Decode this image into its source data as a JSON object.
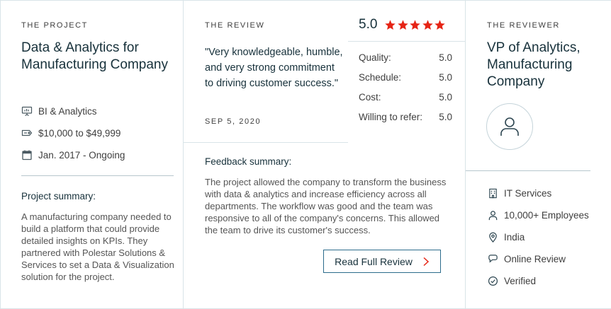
{
  "project": {
    "eyebrow": "THE PROJECT",
    "title": "Data & Analytics for Manufacturing Company",
    "service": "BI & Analytics",
    "budget": "$10,000 to $49,999",
    "timeline": "Jan. 2017 - Ongoing",
    "summary_heading": "Project summary:",
    "summary": "A manufacturing company needed to build a platform that could provide detailed insights on KPIs. They partnered with Polestar Solutions & Services to set a Data & Visualization solution for the project."
  },
  "review": {
    "eyebrow": "THE REVIEW",
    "quote": "\"Very knowledgeable, humble, and very strong commitment to driving customer success.\"",
    "date": "SEP 5, 2020",
    "overall_rating": "5.0",
    "stars": 5,
    "star_color": "#e62415",
    "scores": [
      {
        "label": "Quality:",
        "value": "5.0"
      },
      {
        "label": "Schedule:",
        "value": "5.0"
      },
      {
        "label": "Cost:",
        "value": "5.0"
      },
      {
        "label": "Willing to refer:",
        "value": "5.0"
      }
    ],
    "feedback_heading": "Feedback summary:",
    "feedback": "The project allowed the company to transform the business with data & analytics and increase efficiency across all departments. The workflow was good and the team was responsive to all of the company's concerns. This allowed the team to drive its customer's success.",
    "read_button": "Read Full Review"
  },
  "reviewer": {
    "eyebrow": "THE REVIEWER",
    "title": "VP of Analytics, Manufacturing Company",
    "industry": "IT Services",
    "employees": "10,000+ Employees",
    "location": "India",
    "review_type": "Online Review",
    "verification": "Verified"
  },
  "colors": {
    "accent": "#2c6c8c",
    "star": "#e62415",
    "chevron": "#e62415",
    "divider": "#d9e4e8"
  }
}
